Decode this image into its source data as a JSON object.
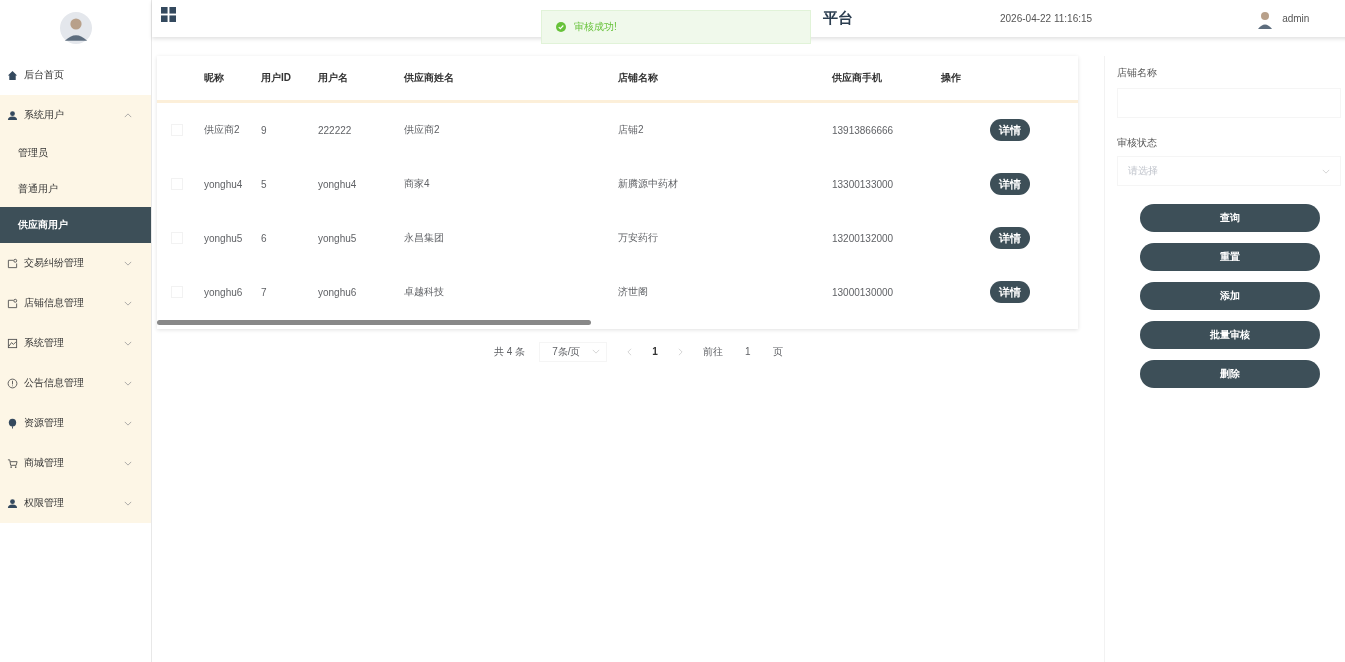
{
  "header": {
    "title": "平台",
    "datetime": "2026-04-22 11:16:15",
    "user": "admin"
  },
  "toast": {
    "message": "审核成功!"
  },
  "sidebar": {
    "items": [
      {
        "label": "后台首页"
      },
      {
        "label": "系统用户",
        "expanded": true,
        "children": [
          {
            "label": "管理员",
            "selected": false
          },
          {
            "label": "普通用户",
            "selected": false
          },
          {
            "label": "供应商用户",
            "selected": true
          }
        ]
      },
      {
        "label": "交易纠纷管理",
        "expanded": false
      },
      {
        "label": "店铺信息管理",
        "expanded": false
      },
      {
        "label": "系统管理",
        "expanded": false
      },
      {
        "label": "公告信息管理",
        "expanded": false
      },
      {
        "label": "资源管理",
        "expanded": false
      },
      {
        "label": "商城管理",
        "expanded": false
      },
      {
        "label": "权限管理",
        "expanded": false
      }
    ]
  },
  "table": {
    "columns": [
      "昵称",
      "用户ID",
      "用户名",
      "供应商姓名",
      "店铺名称",
      "供应商手机",
      "操作"
    ],
    "rows": [
      {
        "checked": false,
        "cells": [
          "供应商2",
          "9",
          "222222",
          "供应商2",
          "店铺2",
          "13913866666"
        ],
        "action": "详情"
      },
      {
        "checked": false,
        "cells": [
          "yonghu4",
          "5",
          "yonghu4",
          "商家4",
          "新腾源中药材",
          "13300133000"
        ],
        "action": "详情"
      },
      {
        "checked": false,
        "cells": [
          "yonghu5",
          "6",
          "yonghu5",
          "永昌集团",
          "万安药行",
          "13200132000"
        ],
        "action": "详情"
      },
      {
        "checked": false,
        "cells": [
          "yonghu6",
          "7",
          "yonghu6",
          "卓越科技",
          "济世阁",
          "13000130000"
        ],
        "action": "详情"
      }
    ]
  },
  "pagination": {
    "total": "共 4 条",
    "page_size": "7条/页",
    "current": "1",
    "goto_label": "前往",
    "goto_value": "1",
    "goto_suffix": "页"
  },
  "filters": {
    "shop_name_label": "店铺名称",
    "status_label": "审核状态",
    "status_placeholder": "请选择"
  },
  "buttons": [
    "查询",
    "重置",
    "添加",
    "批量审核",
    "删除"
  ]
}
